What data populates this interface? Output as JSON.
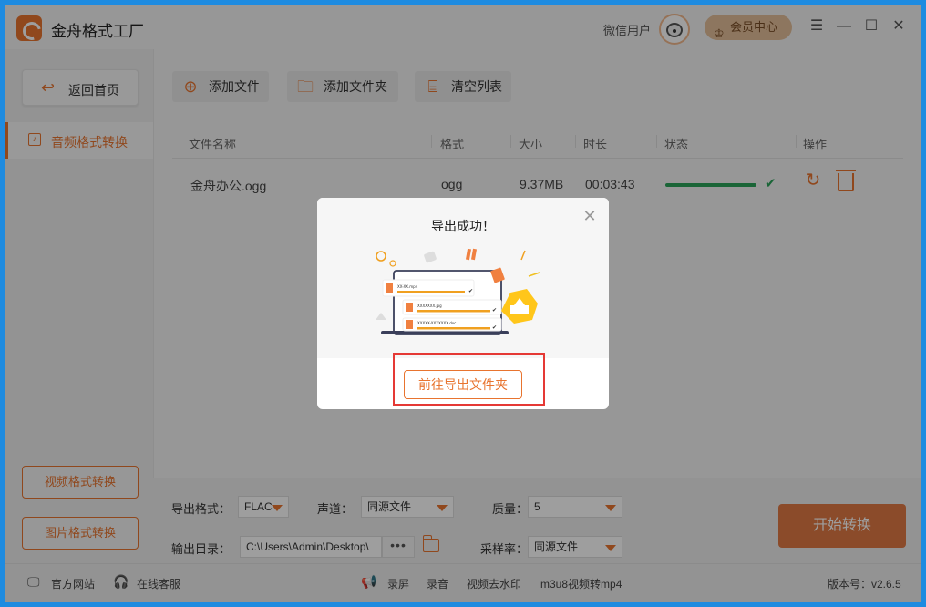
{
  "app": {
    "title": "金舟格式工厂",
    "user_name": "微信用户",
    "vip_label": "会员中心",
    "accent_color": "#e8742f"
  },
  "sidebar": {
    "home_label": "返回首页",
    "active_item": "音频格式转换",
    "video_button": "视频格式转换",
    "image_button": "图片格式转换"
  },
  "toolbar": {
    "add_file": "添加文件",
    "add_folder": "添加文件夹",
    "clear_list": "清空列表"
  },
  "table": {
    "headers": [
      "文件名称",
      "格式",
      "大小",
      "时长",
      "状态",
      "操作"
    ],
    "rows": [
      {
        "name": "金舟办公.ogg",
        "format": "ogg",
        "size": "9.37MB",
        "duration": "00:03:43",
        "progress": 1.0,
        "status": "done"
      }
    ]
  },
  "settings": {
    "format_label": "导出格式：",
    "format_value": "FLAC",
    "channel_label": "声道：",
    "channel_value": "同源文件",
    "quality_label": "质量：",
    "quality_value": "5",
    "output_label": "输出目录：",
    "output_path": "C:\\Users\\Admin\\Desktop\\",
    "more_label": "•••",
    "samplerate_label": "采样率：",
    "samplerate_value": "同源文件",
    "start_label": "开始转换"
  },
  "statusbar": {
    "website": "官方网站",
    "service": "在线客服",
    "record_screen": "录屏",
    "record_audio": "录音",
    "watermark": "视频去水印",
    "m3u8": "m3u8视频转mp4",
    "version": "版本号：v2.6.5"
  },
  "modal": {
    "title": "导出成功！",
    "go_folder": "前往导出文件夹",
    "illus_files": [
      "XX-XX.mp4",
      "XXXXXXX.jpg",
      "XXXXX-XXXXXXX.doc"
    ]
  }
}
